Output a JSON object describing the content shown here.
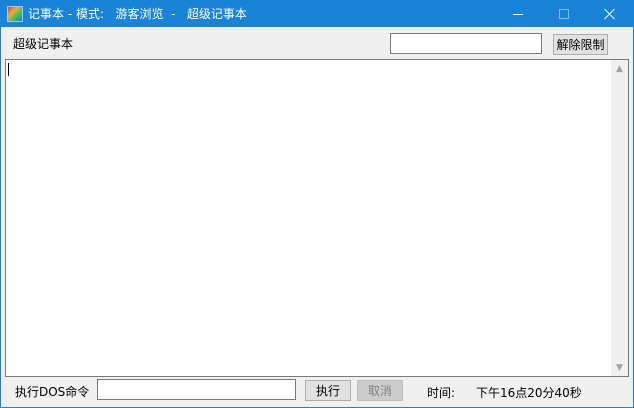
{
  "window": {
    "title": "记事本 - 模式:   游客浏览  -   超级记事本",
    "icon": "notepad-app-icon",
    "accent_color": "#1883d7"
  },
  "toolbar": {
    "label": "超级记事本",
    "password_value": "",
    "unlock_label": "解除限制"
  },
  "editor": {
    "content": ""
  },
  "bottom": {
    "dos_label": "执行DOS命令",
    "command_value": "",
    "execute_label": "执行",
    "cancel_label": "取消",
    "time_label": "时间:",
    "time_value": "下午16点20分40秒"
  }
}
